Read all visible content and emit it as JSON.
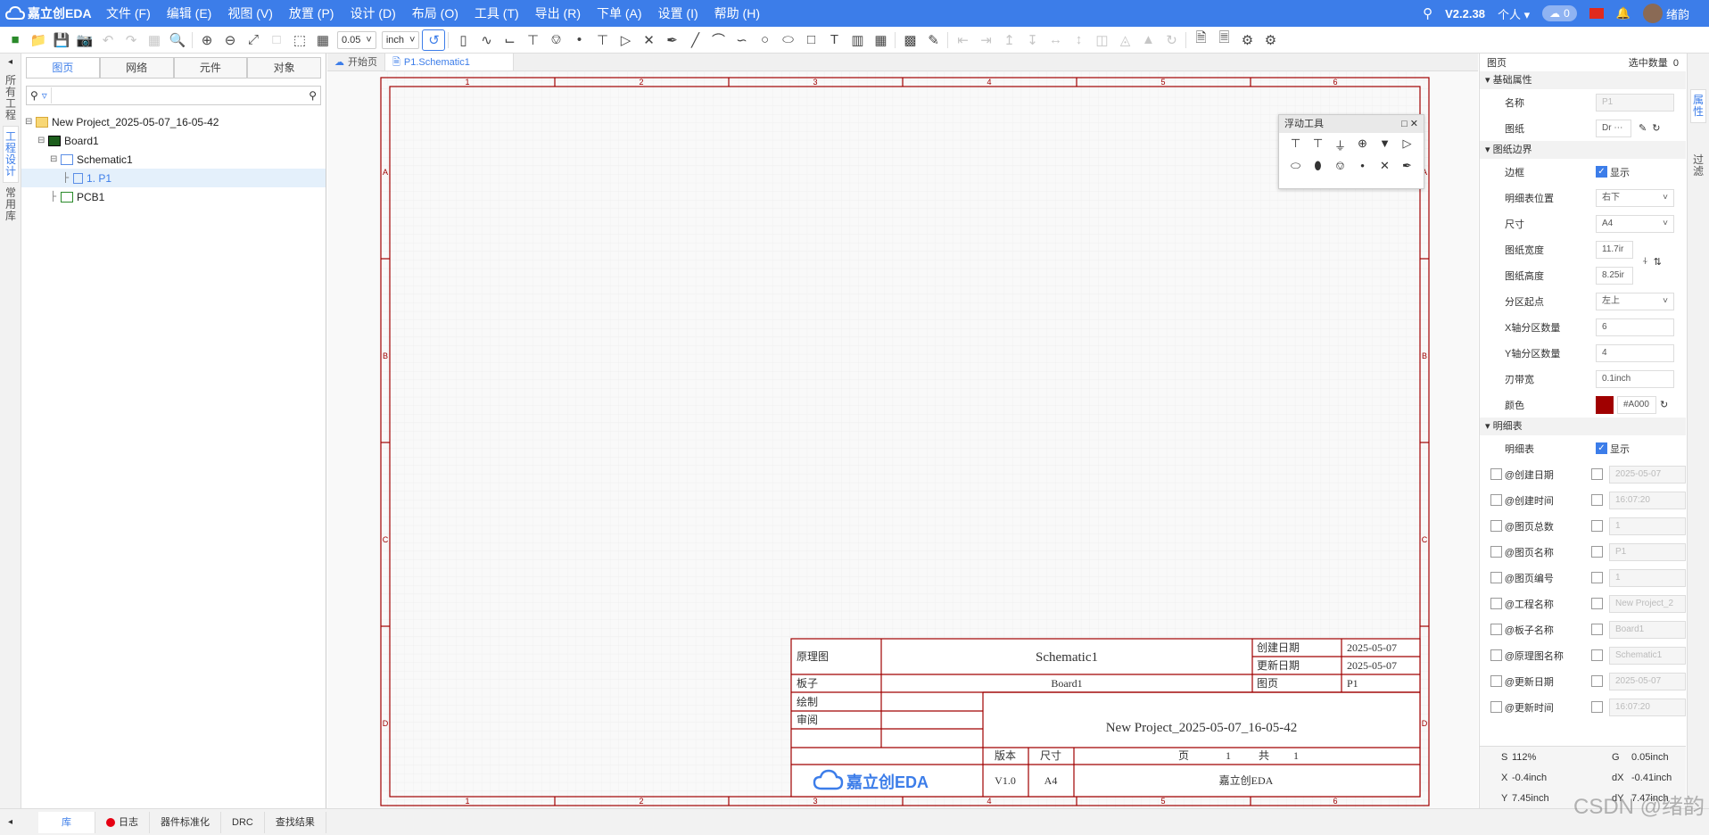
{
  "app": {
    "logo": "嘉立创EDA",
    "version": "V2.2.38",
    "account": "个人",
    "notif_count": "0",
    "user": "绪韵"
  },
  "menu": [
    "文件 (F)",
    "编辑 (E)",
    "视图 (V)",
    "放置 (P)",
    "设计 (D)",
    "布局 (O)",
    "工具 (T)",
    "导出 (R)",
    "下单 (A)",
    "设置 (I)",
    "帮助 (H)"
  ],
  "toolbar": {
    "grid_value": "0.05",
    "unit": "inch"
  },
  "left_strip": {
    "tabs": [
      "所有工程",
      "工程设计",
      "常用库"
    ]
  },
  "left_panel": {
    "tabs": [
      "图页",
      "网络",
      "元件",
      "对象"
    ],
    "tree": {
      "project": "New Project_2025-05-07_16-05-42",
      "board": "Board1",
      "schematic": "Schematic1",
      "page": "1. P1",
      "pcb": "PCB1"
    }
  },
  "doc_tabs": [
    "开始页",
    "P1.Schematic1"
  ],
  "float_tool": {
    "title": "浮动工具"
  },
  "sheet": {
    "col_labels": [
      "1",
      "2",
      "3",
      "4",
      "5",
      "6"
    ],
    "row_labels": [
      "A",
      "B",
      "C",
      "D"
    ],
    "title_block": {
      "label_schematic": "原理图",
      "schematic_name": "Schematic1",
      "label_create_date": "创建日期",
      "create_date": "2025-05-07",
      "label_update_date": "更新日期",
      "update_date": "2025-05-07",
      "label_board": "板子",
      "board_name": "Board1",
      "label_page": "图页",
      "page_name": "P1",
      "label_draw": "绘制",
      "label_review": "审阅",
      "project_name": "New Project_2025-05-07_16-05-42",
      "label_version": "版本",
      "label_size": "尺寸",
      "version": "V1.0",
      "size": "A4",
      "page_text": "页",
      "page_no": "1",
      "total_text": "共",
      "page_total": "1",
      "company": "嘉立创EDA",
      "logo_text": "嘉立创EDA"
    }
  },
  "right_panel": {
    "title": "图页",
    "selected_label": "选中数量",
    "selected_count": "0",
    "sections": {
      "basic": "基础属性",
      "border": "图纸边界",
      "detail": "明细表"
    },
    "basic": [
      {
        "label": "名称",
        "value": "P1"
      },
      {
        "label": "图纸",
        "value": "Dr"
      }
    ],
    "border": [
      {
        "label": "边框",
        "value": "显示",
        "type": "check"
      },
      {
        "label": "明细表位置",
        "value": "右下",
        "type": "select"
      },
      {
        "label": "尺寸",
        "value": "A4",
        "type": "select"
      },
      {
        "label": "图纸宽度",
        "value": "11.7ir",
        "type": "input"
      },
      {
        "label": "图纸高度",
        "value": "8.25ir",
        "type": "input"
      },
      {
        "label": "分区起点",
        "value": "左上",
        "type": "select"
      },
      {
        "label": "X轴分区数量",
        "value": "6",
        "type": "input"
      },
      {
        "label": "Y轴分区数量",
        "value": "4",
        "type": "input"
      },
      {
        "label": "刃带宽",
        "value": "0.1inch",
        "type": "input"
      },
      {
        "label": "颜色",
        "value": "#A000",
        "type": "color"
      }
    ],
    "detail_show": {
      "label": "明细表",
      "value": "显示"
    },
    "detail": [
      {
        "label": "@创建日期",
        "value": "2025-05-07"
      },
      {
        "label": "@创建时间",
        "value": "16:07:20"
      },
      {
        "label": "@图页总数",
        "value": "1"
      },
      {
        "label": "@图页名称",
        "value": "P1"
      },
      {
        "label": "@图页编号",
        "value": "1"
      },
      {
        "label": "@工程名称",
        "value": "New Project_2"
      },
      {
        "label": "@板子名称",
        "value": "Board1"
      },
      {
        "label": "@原理图名称",
        "value": "Schematic1"
      },
      {
        "label": "@更新日期",
        "value": "2025-05-07"
      },
      {
        "label": "@更新时间",
        "value": "16:07:20"
      }
    ],
    "status": {
      "s_label": "S",
      "s_value": "112%",
      "g_label": "G",
      "g_value": "0.05inch",
      "x_label": "X",
      "x_value": "-0.4inch",
      "dx_label": "dX",
      "dx_value": "-0.41inch",
      "y_label": "Y",
      "y_value": "7.45inch",
      "dy_label": "dY",
      "dy_value": "7.47inch"
    }
  },
  "right_side_tabs": [
    "属性",
    "过滤"
  ],
  "bottom_tabs": [
    "库",
    "日志",
    "器件标准化",
    "DRC",
    "查找结果"
  ],
  "watermark": "CSDN @绪韵",
  "colors": {
    "accent": "#3c7de9",
    "sheet_border": "#a00000"
  }
}
